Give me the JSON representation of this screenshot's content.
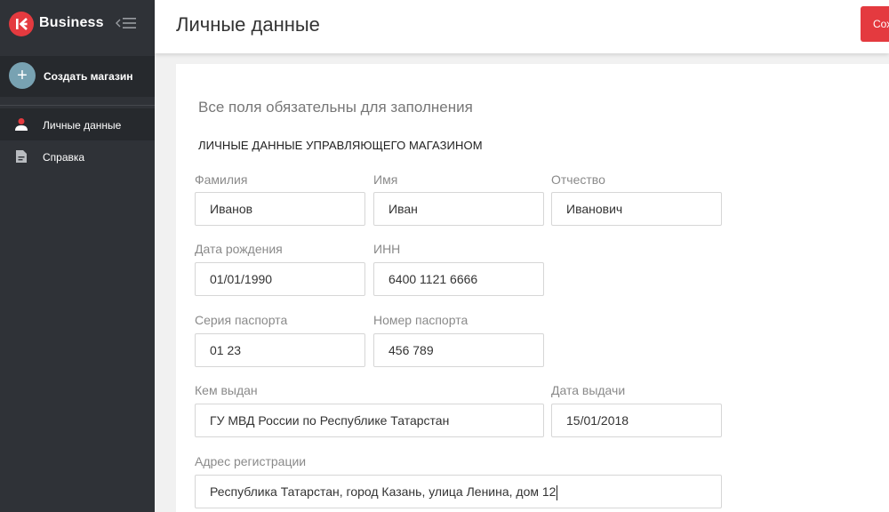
{
  "brand": {
    "name": "Business"
  },
  "sidebar": {
    "create_store": "Создать магазин",
    "items": [
      {
        "label": "Личные данные",
        "icon": "user-icon",
        "active": true
      },
      {
        "label": "Справка",
        "icon": "document-icon",
        "active": false
      }
    ]
  },
  "header": {
    "title": "Личные данные",
    "save_label": "Сохранить"
  },
  "form": {
    "hint": "Все поля обязательны для заполнения",
    "section_title": "ЛИЧНЫЕ ДАННЫЕ УПРАВЛЯЮЩЕГО МАГАЗИНОМ",
    "fields": {
      "last_name": {
        "label": "Фамилия",
        "value": "Иванов"
      },
      "first_name": {
        "label": "Имя",
        "value": "Иван"
      },
      "middle_name": {
        "label": "Отчество",
        "value": "Иванович"
      },
      "birth_date": {
        "label": "Дата рождения",
        "value": "01/01/1990"
      },
      "inn": {
        "label": "ИНН",
        "value": "6400 1121 6666"
      },
      "passport_series": {
        "label": "Серия паспорта",
        "value": "01 23"
      },
      "passport_number": {
        "label": "Номер паспорта",
        "value": "456 789"
      },
      "issued_by": {
        "label": "Кем выдан",
        "value": "ГУ МВД России по Республике Татарстан"
      },
      "issue_date": {
        "label": "Дата выдачи",
        "value": "15/01/2018"
      },
      "address": {
        "label": "Адрес регистрации",
        "value": "Республика Татарстан, город Казань, улица Ленина, дом 12"
      }
    }
  },
  "colors": {
    "accent": "#e43a3f",
    "sidebar": "#2f3237",
    "create_circle": "#78a2b2"
  }
}
